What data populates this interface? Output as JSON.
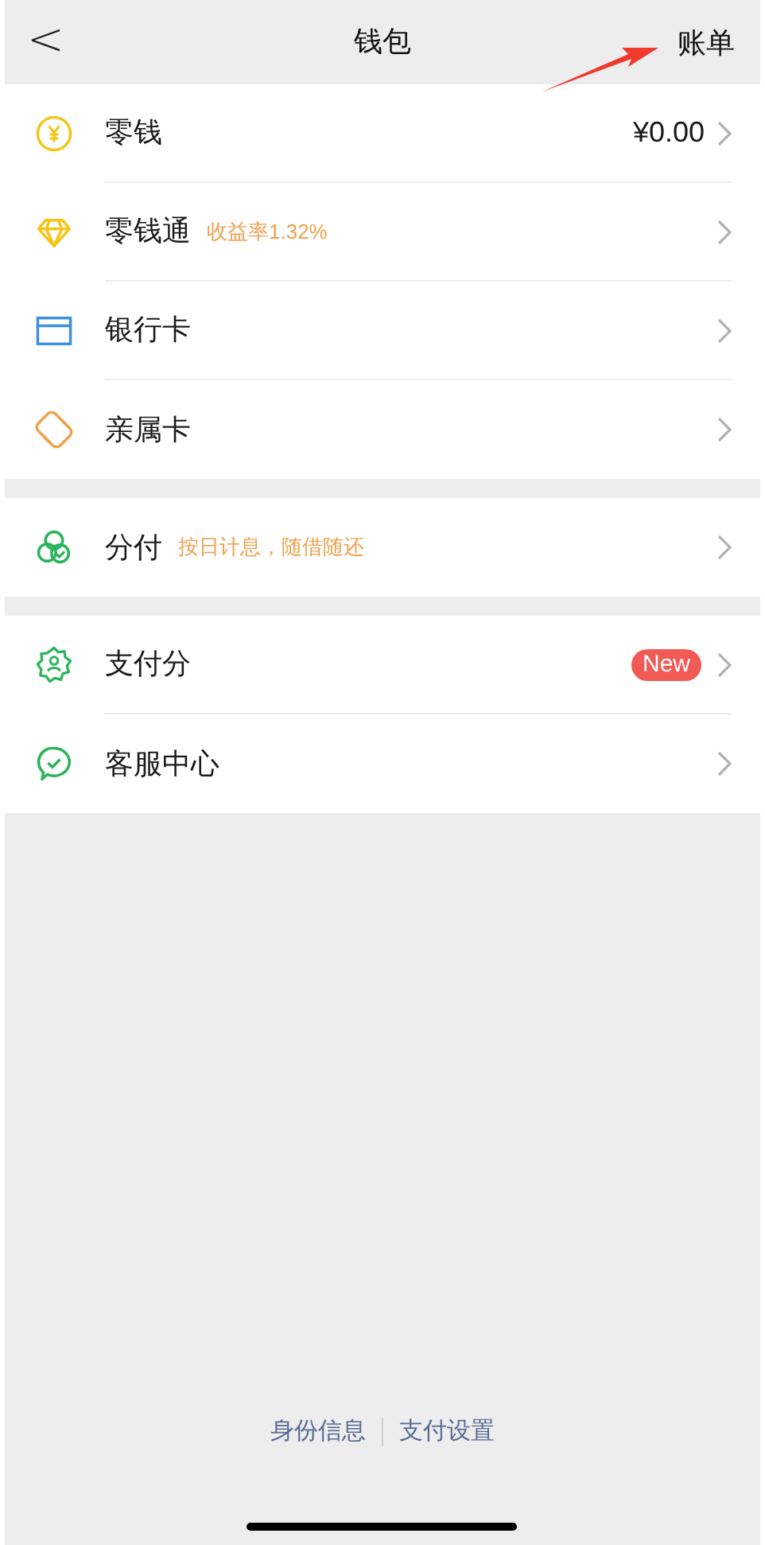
{
  "nav_bar": {
    "back_glyph": "<",
    "title": "钱包",
    "action": "账单"
  },
  "groups": [
    {
      "items": [
        {
          "kind": "coin",
          "label": "零钱",
          "value": "¥0.00"
        },
        {
          "kind": "diamond",
          "label": "零钱通",
          "note": "收益率1.32%"
        },
        {
          "kind": "card",
          "label": "银行卡"
        },
        {
          "kind": "family-card",
          "label": "亲属卡"
        }
      ]
    },
    {
      "items": [
        {
          "kind": "clover",
          "label": "分付",
          "note": "按日计息，随借随还"
        }
      ]
    },
    {
      "items": [
        {
          "kind": "score",
          "label": "支付分",
          "badge": "New"
        },
        {
          "kind": "service",
          "label": "客服中心"
        }
      ]
    }
  ],
  "footer_links": [
    "身份信息",
    "支付设置"
  ]
}
